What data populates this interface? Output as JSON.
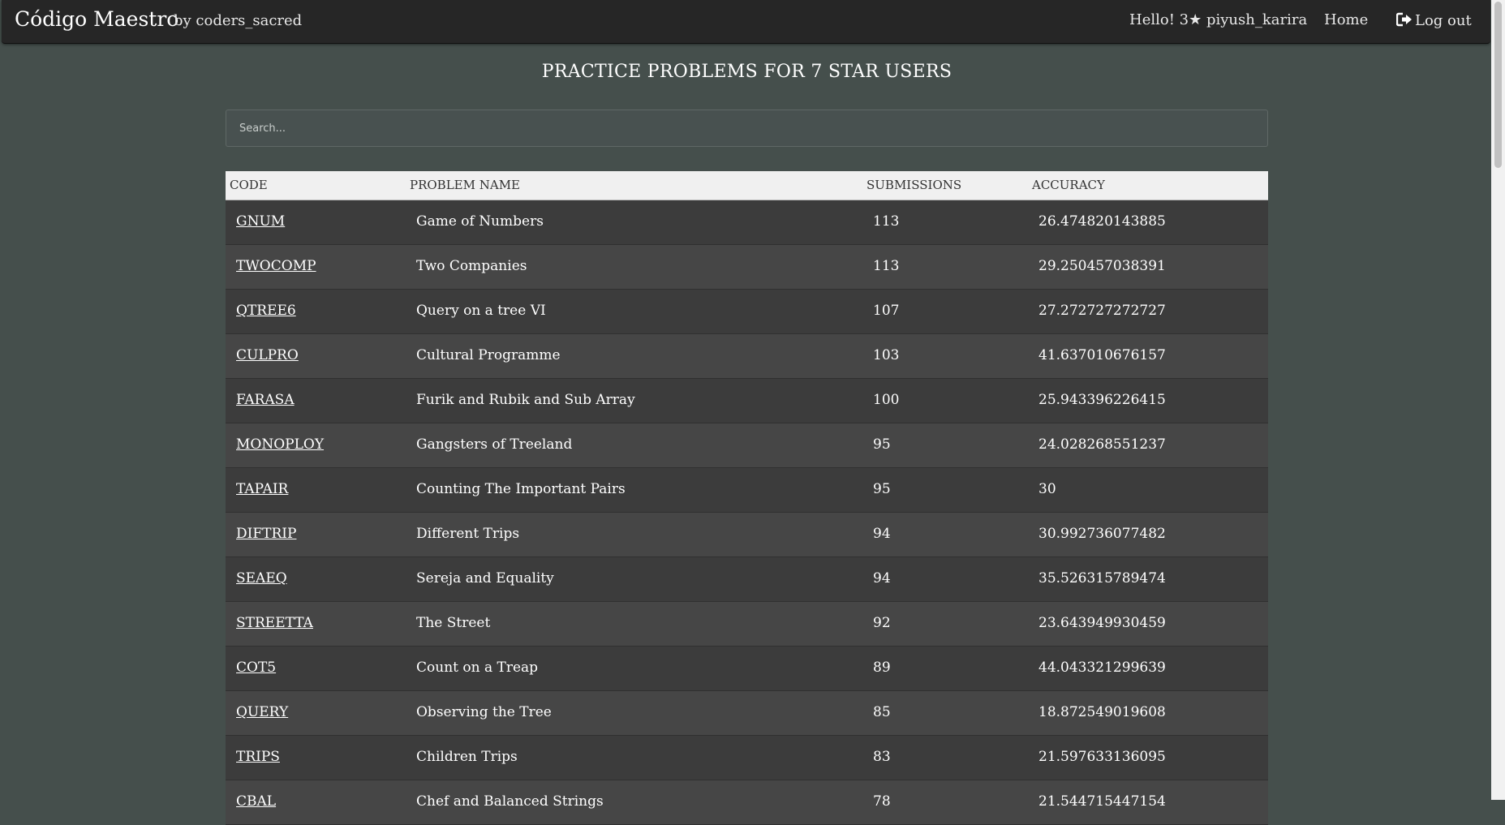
{
  "navbar": {
    "brand": "Código Maestro",
    "byline": "by coders_sacred",
    "greeting": "Hello! 3★ piyush_karira",
    "home_label": "Home",
    "logout_label": "Log out"
  },
  "page_title": "PRACTICE PROBLEMS FOR 7 STAR USERS",
  "search": {
    "placeholder": "Search..."
  },
  "table": {
    "headers": [
      "CODE",
      "PROBLEM NAME",
      "SUBMISSIONS",
      "ACCURACY"
    ],
    "rows": [
      {
        "code": "GNUM",
        "name": "Game of Numbers",
        "submissions": "113",
        "accuracy": "26.474820143885"
      },
      {
        "code": "TWOCOMP",
        "name": "Two Companies",
        "submissions": "113",
        "accuracy": "29.250457038391"
      },
      {
        "code": "QTREE6",
        "name": "Query on a tree VI",
        "submissions": "107",
        "accuracy": "27.272727272727"
      },
      {
        "code": "CULPRO",
        "name": "Cultural Programme",
        "submissions": "103",
        "accuracy": "41.637010676157"
      },
      {
        "code": "FARASA",
        "name": "Furik and Rubik and Sub Array",
        "submissions": "100",
        "accuracy": "25.943396226415"
      },
      {
        "code": "MONOPLOY",
        "name": "Gangsters of Treeland",
        "submissions": "95",
        "accuracy": "24.028268551237"
      },
      {
        "code": "TAPAIR",
        "name": "Counting The Important Pairs",
        "submissions": "95",
        "accuracy": "30"
      },
      {
        "code": "DIFTRIP",
        "name": "Different Trips",
        "submissions": "94",
        "accuracy": "30.992736077482"
      },
      {
        "code": "SEAEQ",
        "name": "Sereja and Equality",
        "submissions": "94",
        "accuracy": "35.526315789474"
      },
      {
        "code": "STREETTA",
        "name": "The Street",
        "submissions": "92",
        "accuracy": "23.643949930459"
      },
      {
        "code": "COT5",
        "name": "Count on a Treap",
        "submissions": "89",
        "accuracy": "44.043321299639"
      },
      {
        "code": "QUERY",
        "name": "Observing the Tree",
        "submissions": "85",
        "accuracy": "18.872549019608"
      },
      {
        "code": "TRIPS",
        "name": "Children Trips",
        "submissions": "83",
        "accuracy": "21.597633136095"
      },
      {
        "code": "CBAL",
        "name": "Chef and Balanced Strings",
        "submissions": "78",
        "accuracy": "21.544715447154"
      }
    ]
  }
}
